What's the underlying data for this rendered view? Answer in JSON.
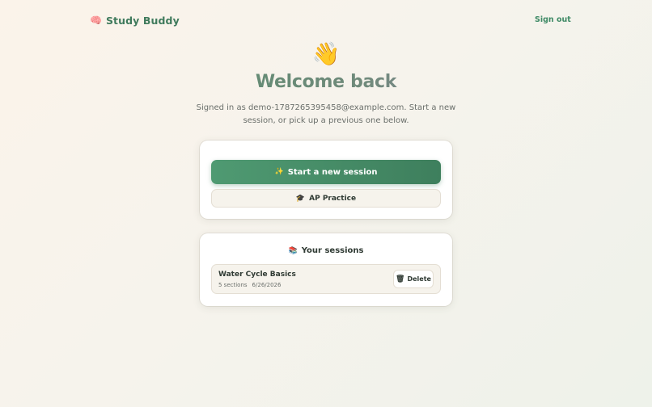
{
  "header": {
    "brand_icon": "🧠",
    "brand_name": "Study Buddy",
    "sign_out_label": "Sign out"
  },
  "hero": {
    "emoji": "👋",
    "title": "Welcome back",
    "subtitle": "Signed in as demo-1787265395458@example.com. Start a new session, or pick up a previous one below."
  },
  "actions": {
    "new_session_icon": "✨",
    "new_session_label": "Start a new session",
    "ap_icon": "🎓",
    "ap_label": "AP Practice"
  },
  "sessions": {
    "title_icon": "📚",
    "title": "Your sessions",
    "items": [
      {
        "name": "Water Cycle Basics",
        "sections": "5 sections",
        "date": "6/26/2026",
        "delete_icon": "🗑",
        "delete_label": "Delete"
      }
    ]
  },
  "colors": {
    "brand": "#3f7a5c",
    "primary_button": "#4a8f6a",
    "title_gradient_end": "#9a7fb5"
  }
}
